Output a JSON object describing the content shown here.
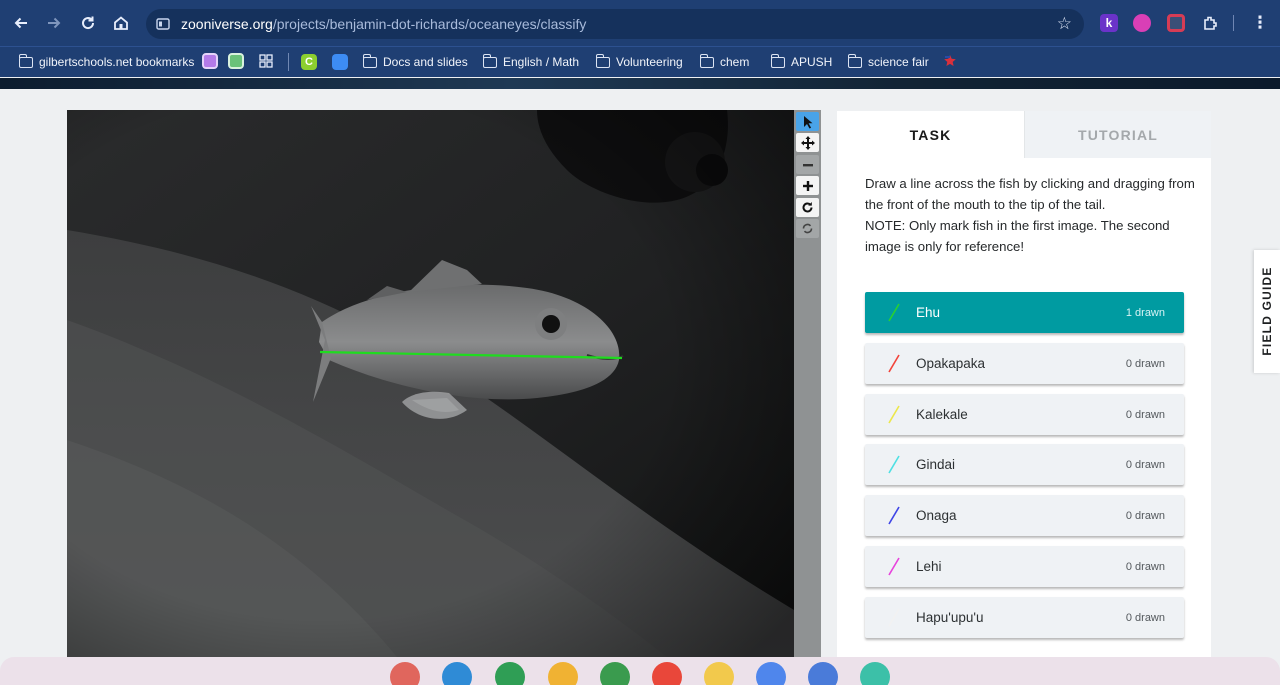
{
  "browser": {
    "url_host": "zooniverse.org",
    "url_path": "/projects/benjamin-dot-richards/oceaneyes/classify",
    "icons": [
      "back-icon",
      "forward-icon",
      "reload-icon",
      "home-icon",
      "site-info-icon",
      "star-icon",
      "extensions-icon",
      "menu-icon"
    ]
  },
  "bookmarks": {
    "items": [
      {
        "label": "gilbertschools.net bookmarks"
      },
      {
        "label": "Docs and slides"
      },
      {
        "label": "English / Math"
      },
      {
        "label": "Volunteering"
      },
      {
        "label": "chem"
      },
      {
        "label": "APUSH"
      },
      {
        "label": "science fair"
      }
    ]
  },
  "viewer": {
    "annotation_color": "#1fdc1f"
  },
  "panel": {
    "tabs": [
      {
        "label": "TASK"
      },
      {
        "label": "TUTORIAL"
      }
    ],
    "instruction_1": "Draw a line across the fish by clicking and dragging from the front of the mouth to the tip of the tail.",
    "instruction_2": "NOTE: Only mark fish in the first image. The second image is only for reference!",
    "options": [
      {
        "label": "Ehu",
        "count": "1 drawn",
        "color": "#29d12f",
        "selected": true
      },
      {
        "label": "Opakapaka",
        "count": "0 drawn",
        "color": "#f2443a",
        "selected": false
      },
      {
        "label": "Kalekale",
        "count": "0 drawn",
        "color": "#ece74b",
        "selected": false
      },
      {
        "label": "Gindai",
        "count": "0 drawn",
        "color": "#4fe0e3",
        "selected": false
      },
      {
        "label": "Onaga",
        "count": "0 drawn",
        "color": "#3f46e6",
        "selected": false
      },
      {
        "label": "Lehi",
        "count": "0 drawn",
        "color": "#e744dc",
        "selected": false
      },
      {
        "label": "Hapu'upu'u",
        "count": "0 drawn",
        "color": "#f2f2f2",
        "selected": false
      }
    ],
    "field_guide_label": "FIELD GUIDE"
  },
  "colors": {
    "browser_chrome": "#1f3f73",
    "selected_option": "#009ba1",
    "active_tool": "#49a3e8"
  }
}
